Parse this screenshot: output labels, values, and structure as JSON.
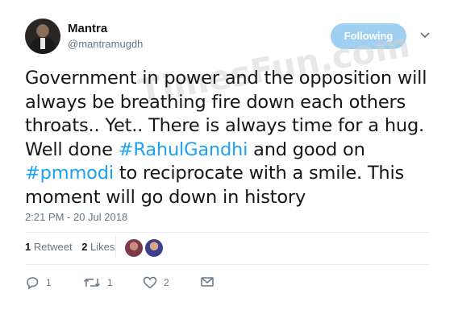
{
  "user": {
    "display_name": "Mantra",
    "handle": "@mantramugdh"
  },
  "follow_button": {
    "label": "Following"
  },
  "tweet": {
    "segments": [
      {
        "text": "Government in power and the opposition will always be breathing fire down each others throats.. Yet.. There is always time for a hug. Well done ",
        "type": "text"
      },
      {
        "text": "#RahulGandhi",
        "type": "hashtag"
      },
      {
        "text": " and good on ",
        "type": "text"
      },
      {
        "text": "#pmmodi",
        "type": "hashtag"
      },
      {
        "text": " to reciprocate with a smile. This moment will go down in history",
        "type": "text"
      }
    ],
    "timestamp": "2:21 PM - 20 Jul 2018"
  },
  "watermark": {
    "text": "TimesFun.com"
  },
  "stats": {
    "retweets_count": "1",
    "retweets_label": "Retweet",
    "likes_count": "2",
    "likes_label": "Likes"
  },
  "actions": {
    "reply_count": "1",
    "retweet_count": "1",
    "like_count": "2"
  },
  "icons": {
    "reply": "reply-icon",
    "retweet": "retweet-icon",
    "like": "heart-icon",
    "dm": "envelope-icon",
    "caret": "chevron-down-icon"
  },
  "colors": {
    "accent": "#1da1f2",
    "follow_button_bg": "#9fd0f2",
    "muted": "#657786"
  }
}
